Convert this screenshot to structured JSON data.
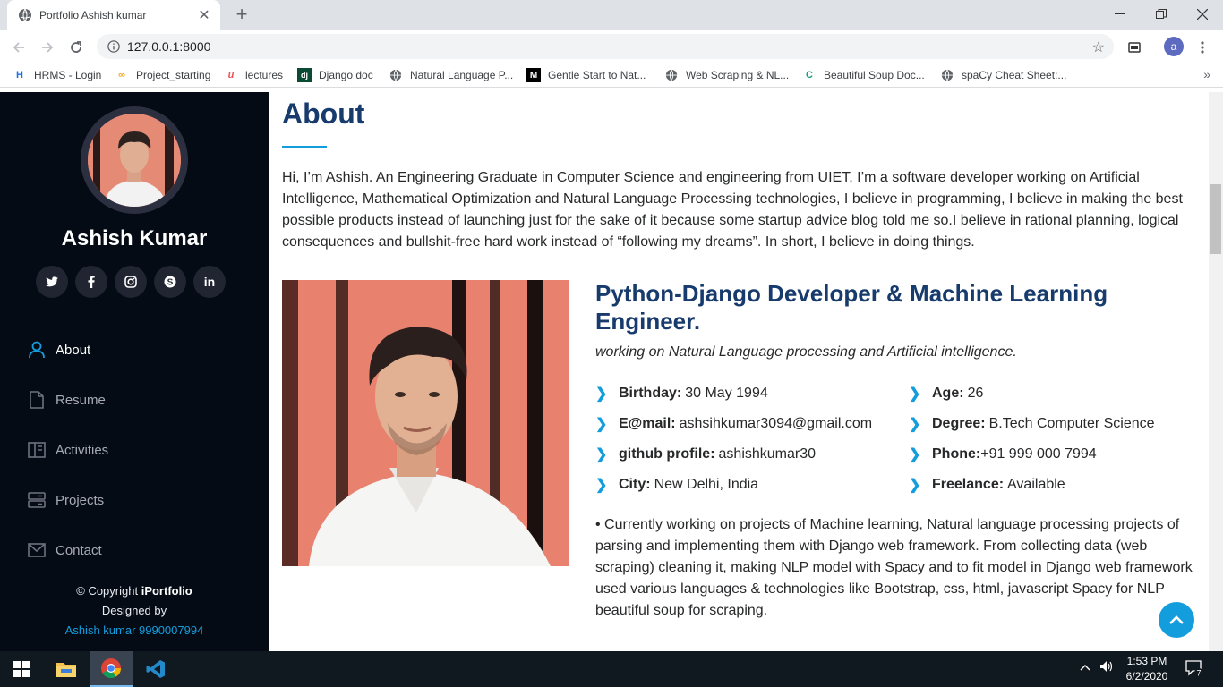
{
  "browser": {
    "tab_title": "Portfolio Ashish kumar",
    "tab_close": "✕",
    "new_tab": "+",
    "url": "127.0.0.1:8000",
    "profile_initial": "a",
    "bookmarks": [
      {
        "label": "HRMS - Login",
        "icon": "hrms-icon",
        "color": "#1a73e8"
      },
      {
        "label": "Project_starting",
        "icon": "loop-icon",
        "color": "#f5a623"
      },
      {
        "label": "lectures",
        "icon": "udemy-icon",
        "color": "#ec5252"
      },
      {
        "label": "Django doc",
        "icon": "django-icon",
        "color": "#0c4b33"
      },
      {
        "label": "Natural Language P...",
        "icon": "globe-icon",
        "color": "#5f6368"
      },
      {
        "label": "Gentle Start to Nat...",
        "icon": "medium-icon",
        "color": "#000000"
      },
      {
        "label": "Web Scraping & NL...",
        "icon": "globe-icon",
        "color": "#5f6368"
      },
      {
        "label": "Beautiful Soup Doc...",
        "icon": "crummy-icon",
        "color": "#14a085"
      },
      {
        "label": "spaCy Cheat Sheet:...",
        "icon": "globe-icon",
        "color": "#5f6368"
      }
    ],
    "bookmarks_more": "»"
  },
  "sidebar": {
    "name": "Ashish Kumar",
    "socials": [
      {
        "name": "twitter-icon",
        "glyph": "t"
      },
      {
        "name": "facebook-icon",
        "glyph": "f"
      },
      {
        "name": "instagram-icon",
        "glyph": "◎"
      },
      {
        "name": "skype-icon",
        "glyph": "S"
      },
      {
        "name": "linkedin-icon",
        "glyph": "in"
      }
    ],
    "nav": [
      {
        "label": "About",
        "icon": "person-icon",
        "active": true
      },
      {
        "label": "Resume",
        "icon": "file-icon",
        "active": false
      },
      {
        "label": "Activities",
        "icon": "book-icon",
        "active": false
      },
      {
        "label": "Projects",
        "icon": "server-icon",
        "active": false
      },
      {
        "label": "Contact",
        "icon": "envelope-icon",
        "active": false
      }
    ],
    "footer": {
      "copyright_prefix": "© Copyright ",
      "brand": "iPortfolio",
      "designed_by": "Designed by",
      "designer": "Ashish kumar 9990007994"
    }
  },
  "about": {
    "title": "About",
    "intro": "Hi, I’m Ashish. An Engineering Graduate in Computer Science and engineering from UIET, I’m a software developer working on Artificial Intelligence, Mathematical Optimization and Natural Language Processing technologies, I believe in programming, I believe in making the best possible products instead of launching just for the sake of it because some startup advice blog told me so.I believe in rational planning, logical consequences and bullshit-free hard work instead of “following my dreams”. In short, I believe in doing things.",
    "job_title": "Python-Django Developer & Machine Learning Engineer.",
    "tagline": "working on Natural Language processing and Artificial intelligence.",
    "info_left": [
      {
        "label": "Birthday:",
        "value": "30 May 1994"
      },
      {
        "label": "E@mail:",
        "value": "ashsihkumar3094@gmail.com"
      },
      {
        "label": "github profile:",
        "value": "ashishkumar30"
      },
      {
        "label": "City:",
        "value": "New Delhi, India"
      }
    ],
    "info_right": [
      {
        "label": "Age:",
        "value": "26"
      },
      {
        "label": "Degree:",
        "value": "B.Tech Computer Science"
      },
      {
        "label": "Phone:",
        "value": "+91 999 000 7994"
      },
      {
        "label": "Freelance:",
        "value": "Available"
      }
    ],
    "description": "• Currently working on projects of Machine learning, Natural language processing projects of parsing and implementing them with Django web framework. From collecting data (web scraping) cleaning it, making NLP model with Spacy and to fit model in Django web framework used various languages & technologies like Bootstrap, css, html, javascript Spacy for NLP beautiful soup for scraping."
  },
  "taskbar": {
    "time": "1:53 PM",
    "date": "6/2/2020",
    "notification_count": "7"
  },
  "colors": {
    "accent": "#149ddd",
    "title": "#173b6c",
    "sidebar_bg": "#040b14"
  }
}
